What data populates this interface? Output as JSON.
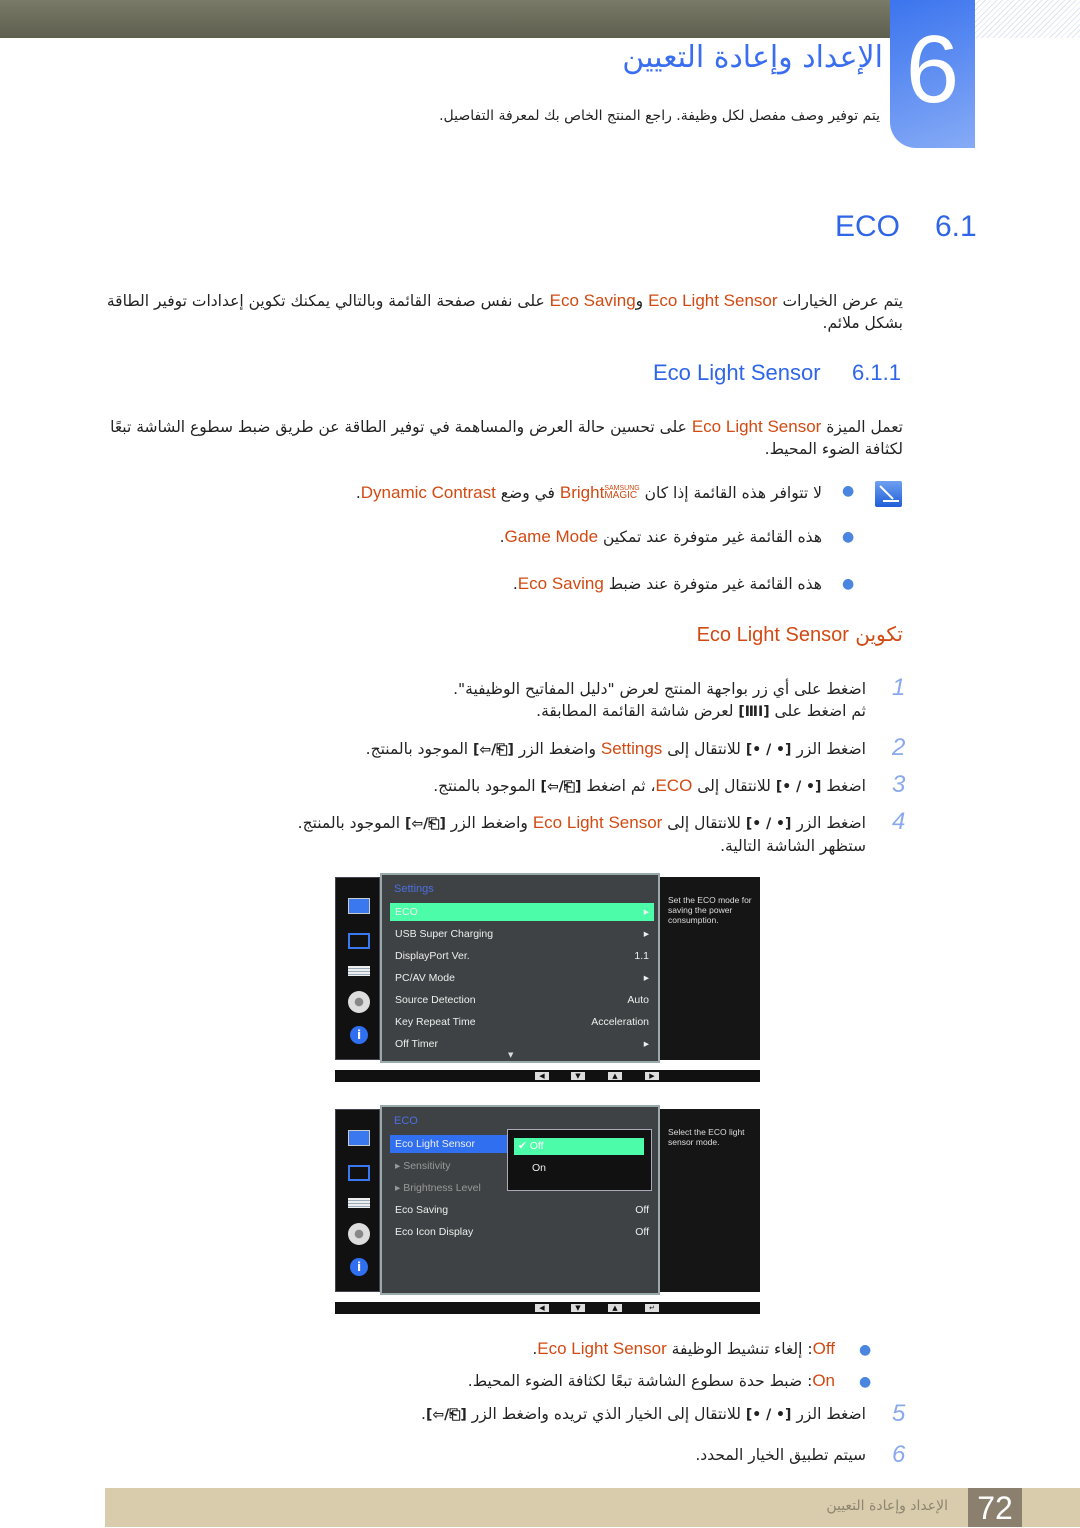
{
  "header": {
    "chapter_number": "6",
    "title": "الإعداد وإعادة التعيين",
    "subtitle": "يتم توفير وصف مفصل لكل وظيفة. راجع المنتج الخاص بك لمعرفة التفاصيل."
  },
  "section": {
    "number": "6.1",
    "title": "ECO",
    "intro": {
      "a": "يتم عرض الخيارات ",
      "b": "Eco Light Sensor",
      "c": " و",
      "d": "Eco Saving",
      "e": " على نفس صفحة القائمة وبالتالي يمكنك تكوين إعدادات توفير الطاقة بشكل ملائم."
    }
  },
  "subsection": {
    "number": "6.1.1",
    "title": "Eco Light Sensor",
    "intro": {
      "a": "تعمل الميزة ",
      "b": "Eco Light Sensor",
      "c": " على تحسين حالة العرض والمساهمة في توفير الطاقة عن طريق ضبط سطوع الشاشة تبعًا لكثافة الضوء المحيط."
    },
    "notes": [
      {
        "a": "لا تتوافر هذه القائمة إذا كان ",
        "brand_top": "SAMSUNG",
        "brand_bottom": "MAGIC",
        "b": "Bright",
        "c": " في وضع ",
        "d": "Dynamic Contrast",
        "e": "."
      },
      {
        "a": "هذه القائمة غير متوفرة عند تمكين ",
        "b": "Game Mode",
        "c": "."
      },
      {
        "a": "هذه القائمة غير متوفرة عند ضبط ",
        "b": "Eco Saving",
        "c": "."
      }
    ],
    "config_heading": {
      "a": "تكوين ",
      "b": "Eco Light Sensor"
    }
  },
  "keys": {
    "move": "[• / •]",
    "enter": "[⎗/⇦]",
    "menu": "[ⅢⅠ]"
  },
  "steps": [
    {
      "num": "1",
      "a": "اضغط على أي زر بواجهة المنتج لعرض \"دليل المفاتيح الوظيفية\".",
      "b": "ثم اضغط على ",
      "c": " لعرض شاشة القائمة المطابقة."
    },
    {
      "num": "2",
      "a": "اضغط الزر ",
      "b": " للانتقال إلى ",
      "c": "Settings",
      "d": " واضغط الزر ",
      "e": " الموجود بالمنتج."
    },
    {
      "num": "3",
      "a": "اضغط ",
      "b": " للانتقال إلى ",
      "c": "ECO",
      "d": "، ثم اضغط ",
      "e": " الموجود بالمنتج."
    },
    {
      "num": "4",
      "a": "اضغط الزر ",
      "b": " للانتقال إلى ",
      "c": "Eco Light Sensor",
      "d": " واضغط الزر ",
      "e": " الموجود بالمنتج.",
      "f": "ستظهر الشاشة التالية."
    },
    {
      "num": "5",
      "a": "اضغط الزر ",
      "b": " للانتقال إلى الخيار الذي تريده واضغط الزر ",
      "c": "."
    },
    {
      "num": "6",
      "a": "سيتم تطبيق الخيار المحدد."
    }
  ],
  "osd1": {
    "title": "Settings",
    "help": "Set the ECO mode for saving the power consumption.",
    "items": [
      {
        "label": "ECO",
        "value": "▸"
      },
      {
        "label": "USB Super Charging",
        "value": "▸"
      },
      {
        "label": "DisplayPort Ver.",
        "value": "1.1"
      },
      {
        "label": "PC/AV Mode",
        "value": "▸"
      },
      {
        "label": "Source Detection",
        "value": "Auto"
      },
      {
        "label": "Key Repeat Time",
        "value": "Acceleration"
      },
      {
        "label": "Off Timer",
        "value": "▸"
      }
    ],
    "nav": [
      "◀",
      "▼",
      "▲",
      "▶"
    ]
  },
  "osd2": {
    "title": "ECO",
    "help": "Select the ECO light sensor mode.",
    "items": [
      {
        "label": "Eco Light Sensor",
        "value": ""
      },
      {
        "label": "▸ Sensitivity",
        "value": ""
      },
      {
        "label": "▸ Brightness Level",
        "value": ""
      },
      {
        "label": "Eco Saving",
        "value": "Off"
      },
      {
        "label": "Eco Icon Display",
        "value": "Off"
      }
    ],
    "options": [
      {
        "label": "Off",
        "checked": true
      },
      {
        "label": "On",
        "checked": false
      }
    ],
    "nav": [
      "◀",
      "▼",
      "▲",
      "↵"
    ]
  },
  "options_desc": [
    {
      "name": "Off",
      "sep": ": ",
      "a": "إلغاء تنشيط الوظيفة ",
      "b": "Eco Light Sensor",
      "c": "."
    },
    {
      "name": "On",
      "sep": ": ",
      "a": "ضبط حدة سطوع الشاشة تبعًا لكثافة الضوء المحيط.",
      "b": "",
      "c": ""
    }
  ],
  "footer": {
    "page": "72",
    "chapter": "الإعداد وإعادة التعيين"
  },
  "colors": {
    "accent_blue": "#3a6ef0",
    "highlight_orange": "#d24a12",
    "osd_select": "#4dfca8",
    "footer": "#d8ccac"
  }
}
